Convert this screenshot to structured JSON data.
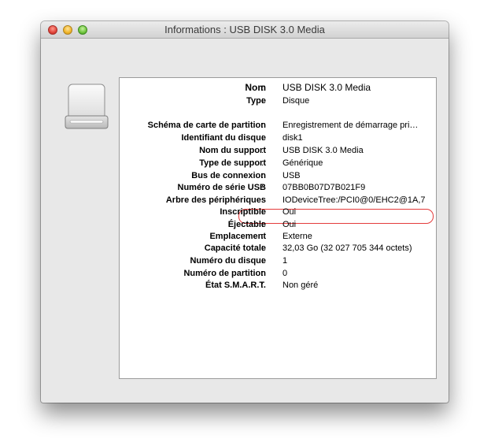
{
  "window": {
    "title": "Informations : USB DISK 3.0 Media"
  },
  "icons": {
    "close": "close-button",
    "minimize": "minimize-button",
    "zoom": "zoom-button",
    "drive": "external-drive-icon"
  },
  "colors": {
    "highlight": "#e43b3b"
  },
  "info": {
    "rows": [
      {
        "label": "Nom",
        "value": "USB DISK 3.0 Media"
      },
      {
        "label": "Type",
        "value": "Disque"
      },
      {
        "label": "Schéma de carte de partition",
        "value": "Enregistrement de démarrage pri…"
      },
      {
        "label": "Identifiant du disque",
        "value": "disk1"
      },
      {
        "label": "Nom du support",
        "value": "USB DISK 3.0 Media"
      },
      {
        "label": "Type de support",
        "value": "Générique"
      },
      {
        "label": "Bus de connexion",
        "value": "USB"
      },
      {
        "label": "Numéro de série USB",
        "value": "07BB0B07D7B021F9"
      },
      {
        "label": "Arbre des périphériques",
        "value": "IODeviceTree:/PCI0@0/EHC2@1A,7"
      },
      {
        "label": "Inscriptible",
        "value": "Oui"
      },
      {
        "label": "Éjectable",
        "value": "Oui"
      },
      {
        "label": "Emplacement",
        "value": "Externe"
      },
      {
        "label": "Capacité totale",
        "value": "32,03 Go (32 027 705 344 octets)"
      },
      {
        "label": "Numéro du disque",
        "value": "1"
      },
      {
        "label": "Numéro de partition",
        "value": "0"
      },
      {
        "label": "État S.M.A.R.T.",
        "value": "Non géré"
      }
    ]
  }
}
